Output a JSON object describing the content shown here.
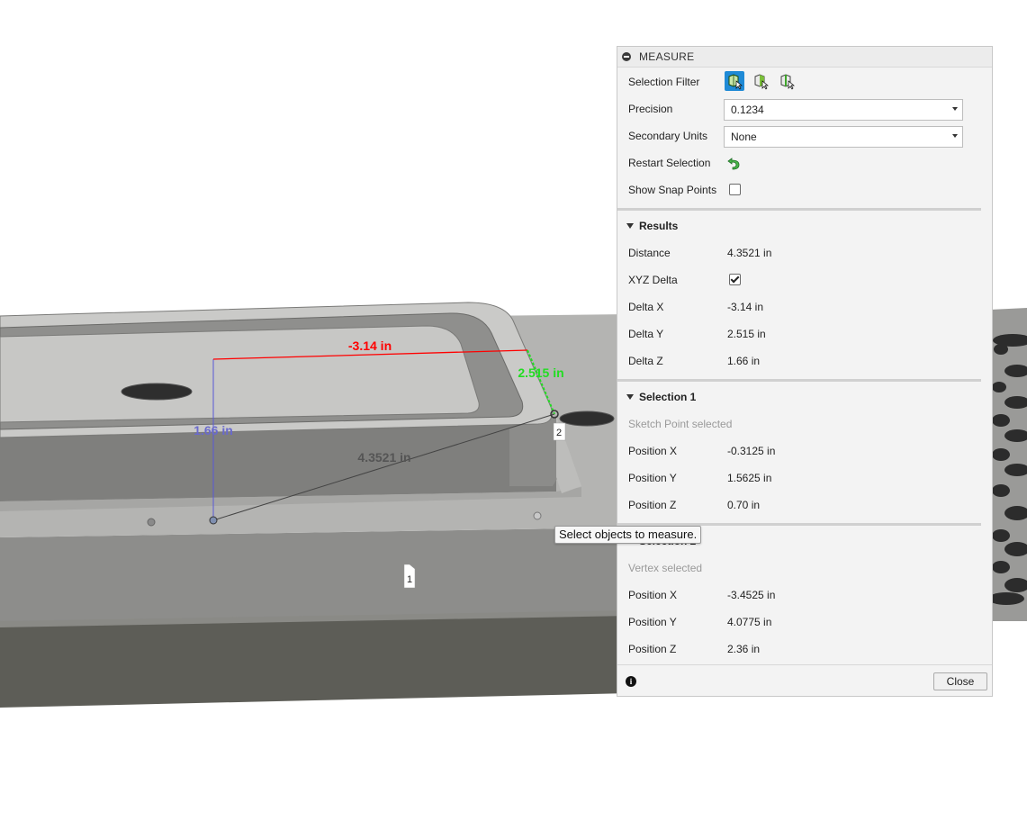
{
  "viewport": {
    "dimensions": {
      "delta_x": "-3.14 in",
      "delta_y": "2.515 in",
      "delta_z": "1.66 in",
      "distance": "4.3521 in"
    },
    "markers": {
      "point1": "1",
      "point2": "2"
    },
    "tooltip": "Select objects to measure."
  },
  "panel": {
    "title": "MEASURE",
    "selection_filter_label": "Selection Filter",
    "precision_label": "Precision",
    "precision_value": "0.1234",
    "secondary_units_label": "Secondary Units",
    "secondary_units_value": "None",
    "restart_selection_label": "Restart Selection",
    "show_snap_points_label": "Show Snap Points",
    "show_snap_points_checked": false,
    "results": {
      "header": "Results",
      "distance_label": "Distance",
      "distance_value": "4.3521 in",
      "xyz_delta_label": "XYZ Delta",
      "xyz_delta_checked": true,
      "delta_x_label": "Delta X",
      "delta_x_value": "-3.14 in",
      "delta_y_label": "Delta Y",
      "delta_y_value": "2.515 in",
      "delta_z_label": "Delta Z",
      "delta_z_value": "1.66 in"
    },
    "selection1": {
      "header": "Selection 1",
      "status": "Sketch Point selected",
      "position_x_label": "Position X",
      "position_x_value": "-0.3125 in",
      "position_y_label": "Position Y",
      "position_y_value": "1.5625 in",
      "position_z_label": "Position Z",
      "position_z_value": "0.70 in"
    },
    "selection2": {
      "header": "Selection 2",
      "status": "Vertex selected",
      "position_x_label": "Position X",
      "position_x_value": "-3.4525 in",
      "position_y_label": "Position Y",
      "position_y_value": "4.0775 in",
      "position_z_label": "Position Z",
      "position_z_value": "2.36 in"
    },
    "close_label": "Close"
  },
  "colors": {
    "accent": "#1f8ad6",
    "delta_x": "#ff0000",
    "delta_y": "#22dd22",
    "delta_z": "#6a6acc",
    "restart_icon": "#2f9a3a"
  },
  "icons": [
    "collapse-icon",
    "select-body-icon",
    "select-face-icon",
    "select-edge-icon",
    "restart-icon",
    "info-icon"
  ]
}
